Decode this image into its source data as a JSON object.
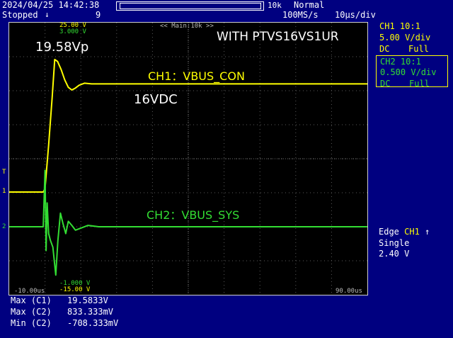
{
  "header": {
    "datetime": "2024/04/25 14:42:38",
    "acq_state": "Stopped",
    "trigger_glyph": "↓",
    "acq_count": "9",
    "memory_length": "10k",
    "acq_mode": "Normal",
    "sample_rate": "100MS/s",
    "time_div": "10µs/div"
  },
  "channels": {
    "ch1": {
      "title": "CH1 10:1",
      "scale": "5.00 V/div",
      "coupling": "DC",
      "bandwidth": "Full",
      "color": "#ffff00"
    },
    "ch2": {
      "title": "CH2 10:1",
      "scale": "0.500 V/div",
      "coupling": "DC",
      "bandwidth": "Full",
      "color": "#33dd33"
    }
  },
  "trigger": {
    "type": "Edge",
    "source": "CH1",
    "edge_glyph": "↑",
    "mode": "Single",
    "level": "2.40 V"
  },
  "screen": {
    "ch1_top": "25.00 V",
    "ch2_top": "3.000 V",
    "ch2_bottom": "-1.000 V",
    "ch1_bottom": "-15.00 V",
    "zoom_label": "<< Main:10k >>",
    "time_left": "-10.00us",
    "time_right": "90.00us",
    "trigger_marker": "T",
    "ch1_marker": "1",
    "ch2_marker": "2"
  },
  "annotations": {
    "title": "WITH PTVS16VS1UR",
    "peak": "19.58Vp",
    "ch1_label": "CH1：VBUS_CON",
    "dc_label": "16VDC",
    "ch2_label": "CH2：VBUS_SYS"
  },
  "measurements": [
    {
      "name": "Max (C1)",
      "value": "19.5833V"
    },
    {
      "name": "Max (C2)",
      "value": "833.333mV"
    },
    {
      "name": "Min (C2)",
      "value": "-708.333mV"
    }
  ],
  "chart_data": {
    "type": "line",
    "title": "WITH PTVS16VS1UR",
    "xlabel": "",
    "ylabel": "",
    "xlim": [
      -10,
      90
    ],
    "x_units": "us",
    "grid": true,
    "series": [
      {
        "name": "CH1：VBUS_CON",
        "units": "V",
        "ylim": [
          -15,
          25
        ],
        "x": [
          -10,
          -0.5,
          0,
          1,
          2,
          2.7,
          3.5,
          4.5,
          5.5,
          6.5,
          7.5,
          8.5,
          9.5,
          11,
          13,
          16,
          20,
          30,
          50,
          70,
          90
        ],
        "values": [
          0.1,
          0.1,
          0.6,
          7.0,
          14.0,
          19.58,
          19.3,
          18.1,
          16.6,
          15.5,
          15.1,
          15.4,
          15.8,
          16.1,
          16.0,
          16.0,
          16.0,
          16.0,
          16.0,
          16.0,
          16.0
        ]
      },
      {
        "name": "CH2：VBUS_SYS",
        "units": "V",
        "ylim": [
          -1,
          3
        ],
        "x": [
          -10,
          -0.5,
          0,
          0.3,
          0.6,
          1.0,
          1.5,
          2.2,
          3.0,
          3.6,
          4.3,
          5.0,
          5.8,
          6.5,
          7.5,
          8.5,
          10,
          12,
          15,
          20,
          30,
          50,
          70,
          90
        ],
        "values": [
          0.0,
          0.0,
          0.83,
          -0.35,
          0.35,
          -0.1,
          -0.2,
          -0.3,
          -0.71,
          -0.2,
          0.2,
          0.05,
          -0.1,
          0.08,
          0.02,
          -0.05,
          -0.02,
          0.02,
          0.0,
          0.0,
          0.0,
          0.0,
          0.0,
          0.0
        ]
      }
    ]
  }
}
